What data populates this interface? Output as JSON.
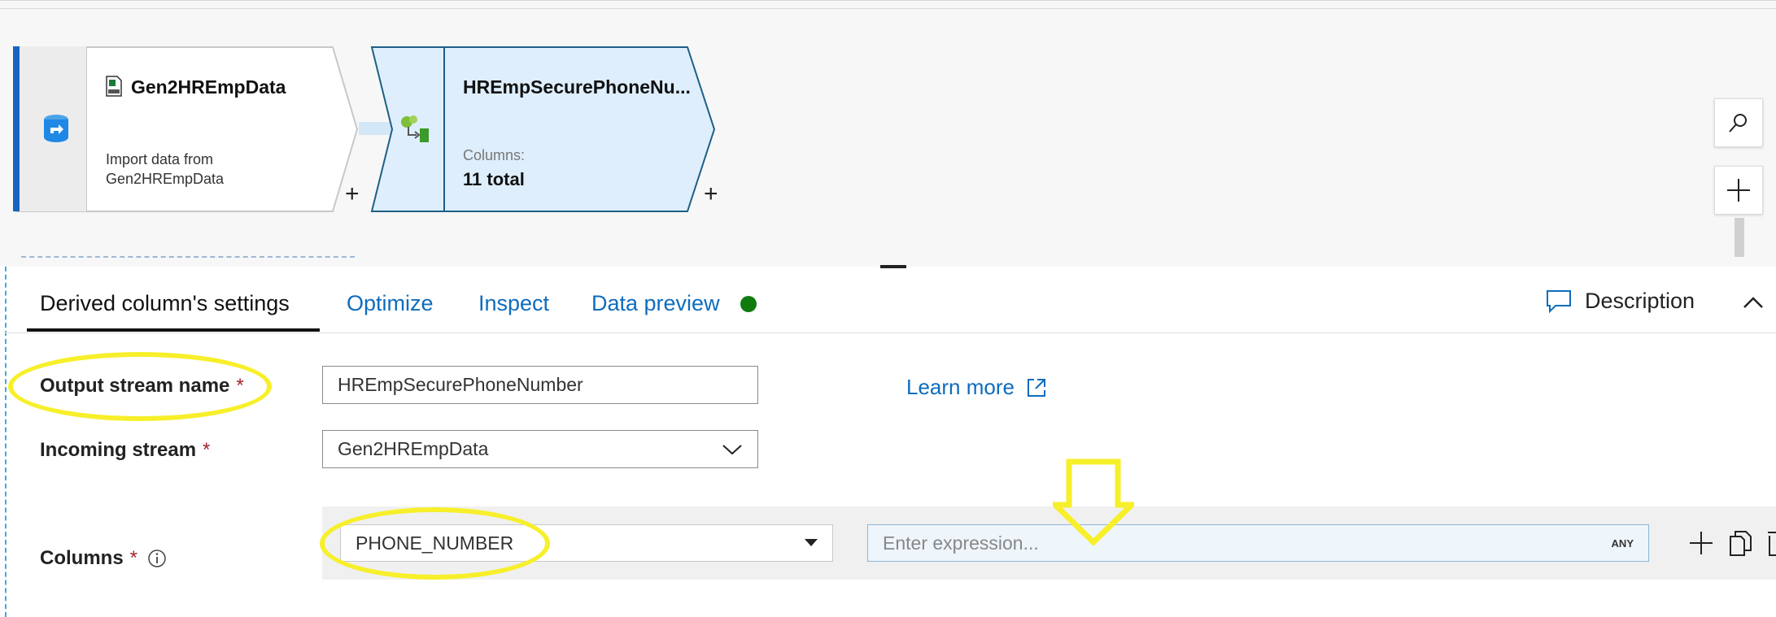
{
  "canvas": {
    "source_node": {
      "title": "Gen2HREmpData",
      "description_line1": "Import data from",
      "description_line2": "Gen2HREmpData",
      "icon": "database-source-icon",
      "file_icon": "csv-file-icon"
    },
    "derived_node": {
      "title": "HREmpSecurePhoneNu...",
      "columns_label": "Columns:",
      "columns_value": "11 total",
      "icon": "derived-column-icon"
    },
    "add_symbol": "+",
    "side_tools": [
      "search-icon",
      "plus-icon"
    ]
  },
  "panel": {
    "tabs": [
      {
        "label": "Derived column's settings",
        "active": true
      },
      {
        "label": "Optimize",
        "active": false
      },
      {
        "label": "Inspect",
        "active": false
      },
      {
        "label": "Data preview",
        "active": false
      }
    ],
    "description_label": "Description",
    "fields": {
      "output_stream_label": "Output stream name",
      "output_stream_value": "HREmpSecurePhoneNumber",
      "incoming_stream_label": "Incoming stream",
      "incoming_stream_value": "Gen2HREmpData",
      "columns_label": "Columns",
      "column_name_value": "PHONE_NUMBER",
      "expression_placeholder": "Enter expression...",
      "expression_type_badge": "ANY",
      "required_marker": "*"
    },
    "learn_more": "Learn more"
  },
  "colors": {
    "accent": "#0f6cbd",
    "node_selected_fill": "#deeefc",
    "node_selected_border": "#1e5f86",
    "source_stripe": "#1565c0",
    "status_green": "#107c10",
    "annotation_yellow": "#f7ef2a",
    "required_red": "#a4262c"
  }
}
